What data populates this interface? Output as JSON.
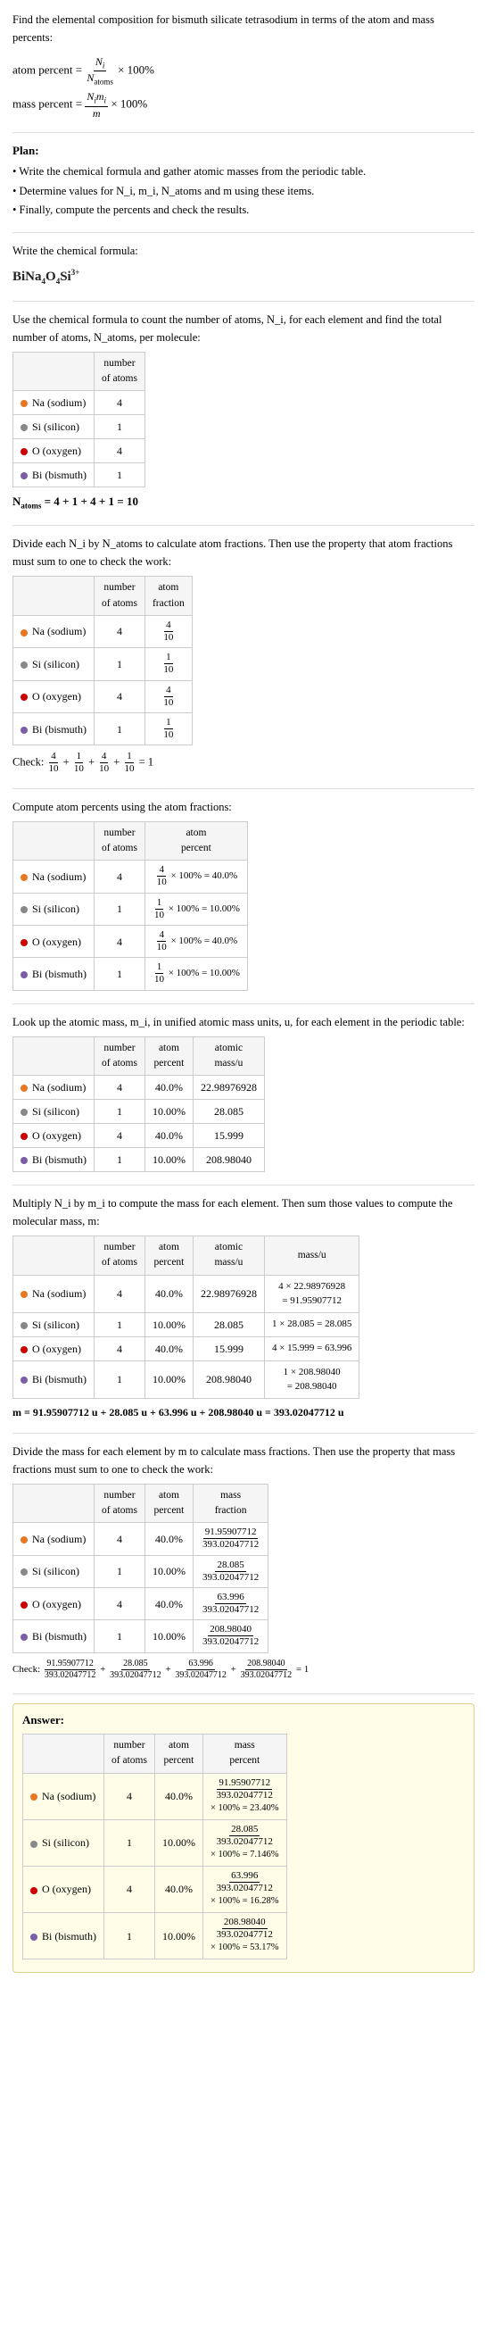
{
  "intro": {
    "title": "Find the elemental composition for bismuth silicate tetrasodium in terms of the atom and mass percents:",
    "atom_percent_formula": "atom percent = (N_i / N_atoms) × 100%",
    "mass_percent_formula": "mass percent = (N_i m_i / m) × 100%"
  },
  "plan": {
    "label": "Plan:",
    "steps": [
      "Write the chemical formula and gather atomic masses from the periodic table.",
      "Determine values for N_i, m_i, N_atoms and m using these items.",
      "Finally, compute the percents and check the results."
    ]
  },
  "formula": {
    "label": "Write the chemical formula:",
    "value": "BiNa₄O₄Si³⁺"
  },
  "step1": {
    "intro": "Use the chemical formula to count the number of atoms, N_i, for each element and find the total number of atoms, N_atoms, per molecule:",
    "columns": [
      "",
      "number of atoms"
    ],
    "rows": [
      {
        "element": "Na (sodium)",
        "color": "orange",
        "n_atoms": "4"
      },
      {
        "element": "Si (silicon)",
        "color": "gray",
        "n_atoms": "1"
      },
      {
        "element": "O (oxygen)",
        "color": "red",
        "n_atoms": "4"
      },
      {
        "element": "Bi (bismuth)",
        "color": "purple",
        "n_atoms": "1"
      }
    ],
    "natoms_eq": "N_atoms = 4 + 1 + 4 + 1 = 10"
  },
  "step2": {
    "intro": "Divide each N_i by N_atoms to calculate atom fractions. Then use the property that atom fractions must sum to one to check the work:",
    "columns": [
      "",
      "number of atoms",
      "atom fraction"
    ],
    "rows": [
      {
        "element": "Na (sodium)",
        "color": "orange",
        "n_atoms": "4",
        "fraction": "4/10"
      },
      {
        "element": "Si (silicon)",
        "color": "gray",
        "n_atoms": "1",
        "fraction": "1/10"
      },
      {
        "element": "O (oxygen)",
        "color": "red",
        "n_atoms": "4",
        "fraction": "4/10"
      },
      {
        "element": "Bi (bismuth)",
        "color": "purple",
        "n_atoms": "1",
        "fraction": "1/10"
      }
    ],
    "check": "Check: 4/10 + 1/10 + 4/10 + 1/10 = 1"
  },
  "step3": {
    "intro": "Compute atom percents using the atom fractions:",
    "columns": [
      "",
      "number of atoms",
      "atom percent"
    ],
    "rows": [
      {
        "element": "Na (sodium)",
        "color": "orange",
        "n_atoms": "4",
        "percent_calc": "4/10 × 100% = 40.0%"
      },
      {
        "element": "Si (silicon)",
        "color": "gray",
        "n_atoms": "1",
        "percent_calc": "1/10 × 100% = 10.00%"
      },
      {
        "element": "O (oxygen)",
        "color": "red",
        "n_atoms": "4",
        "percent_calc": "4/10 × 100% = 40.0%"
      },
      {
        "element": "Bi (bismuth)",
        "color": "purple",
        "n_atoms": "1",
        "percent_calc": "1/10 × 100% = 10.00%"
      }
    ]
  },
  "step4": {
    "intro": "Look up the atomic mass, m_i, in unified atomic mass units, u, for each element in the periodic table:",
    "columns": [
      "",
      "number of atoms",
      "atom percent",
      "atomic mass/u"
    ],
    "rows": [
      {
        "element": "Na (sodium)",
        "color": "orange",
        "n_atoms": "4",
        "atom_pct": "40.0%",
        "mass": "22.98976928"
      },
      {
        "element": "Si (silicon)",
        "color": "gray",
        "n_atoms": "1",
        "atom_pct": "10.00%",
        "mass": "28.085"
      },
      {
        "element": "O (oxygen)",
        "color": "red",
        "n_atoms": "4",
        "atom_pct": "40.0%",
        "mass": "15.999"
      },
      {
        "element": "Bi (bismuth)",
        "color": "purple",
        "n_atoms": "1",
        "atom_pct": "10.00%",
        "mass": "208.98040"
      }
    ]
  },
  "step5": {
    "intro": "Multiply N_i by m_i to compute the mass for each element. Then sum those values to compute the molecular mass, m:",
    "columns": [
      "",
      "number of atoms",
      "atom percent",
      "atomic mass/u",
      "mass/u"
    ],
    "rows": [
      {
        "element": "Na (sodium)",
        "color": "orange",
        "n_atoms": "4",
        "atom_pct": "40.0%",
        "mass": "22.98976928",
        "mass_calc": "4 × 22.98976928\n= 91.95907712"
      },
      {
        "element": "Si (silicon)",
        "color": "gray",
        "n_atoms": "1",
        "atom_pct": "10.00%",
        "mass": "28.085",
        "mass_calc": "1 × 28.085 = 28.085"
      },
      {
        "element": "O (oxygen)",
        "color": "red",
        "n_atoms": "4",
        "atom_pct": "40.0%",
        "mass": "15.999",
        "mass_calc": "4 × 15.999 = 63.996"
      },
      {
        "element": "Bi (bismuth)",
        "color": "purple",
        "n_atoms": "1",
        "atom_pct": "10.00%",
        "mass": "208.98040",
        "mass_calc": "1 × 208.98040\n= 208.98040"
      }
    ],
    "m_eq": "m = 91.95907712 u + 28.085 u + 63.996 u + 208.98040 u = 393.02047712 u"
  },
  "step6": {
    "intro": "Divide the mass for each element by m to calculate mass fractions. Then use the property that mass fractions must sum to one to check the work:",
    "columns": [
      "",
      "number of atoms",
      "atom percent",
      "mass fraction"
    ],
    "rows": [
      {
        "element": "Na (sodium)",
        "color": "orange",
        "n_atoms": "4",
        "atom_pct": "40.0%",
        "fraction": "91.95907712/393.02047712"
      },
      {
        "element": "Si (silicon)",
        "color": "gray",
        "n_atoms": "1",
        "atom_pct": "10.00%",
        "fraction": "28.085/393.02047712"
      },
      {
        "element": "O (oxygen)",
        "color": "red",
        "n_atoms": "4",
        "atom_pct": "40.0%",
        "fraction": "63.996/393.02047712"
      },
      {
        "element": "Bi (bismuth)",
        "color": "purple",
        "n_atoms": "1",
        "atom_pct": "10.00%",
        "fraction": "208.98040/393.02047712"
      }
    ],
    "check": "Check: 91.95907712/393.02047712 + 28.085/393.02047712 + 63.996/393.02047712 + 208.98040/393.02047712 = 1"
  },
  "answer": {
    "label": "Answer:",
    "columns": [
      "",
      "number of atoms",
      "atom percent",
      "mass percent"
    ],
    "rows": [
      {
        "element": "Na (sodium)",
        "color": "orange",
        "n_atoms": "4",
        "atom_pct": "40.0%",
        "mass_pct_calc": "91.95907712/393.02047712\n× 100% = 23.40%"
      },
      {
        "element": "Si (silicon)",
        "color": "gray",
        "n_atoms": "1",
        "atom_pct": "10.00%",
        "mass_pct_calc": "28.085/393.02047712\n× 100% = 7.146%"
      },
      {
        "element": "O (oxygen)",
        "color": "red",
        "n_atoms": "4",
        "atom_pct": "40.0%",
        "mass_pct_calc": "63.996/393.02047712\n× 100% = 16.28%"
      },
      {
        "element": "Bi (bismuth)",
        "color": "purple",
        "n_atoms": "1",
        "atom_pct": "10.00%",
        "mass_pct_calc": "208.98040/393.02047712\n× 100% = 53.17%"
      }
    ]
  },
  "colors": {
    "orange": "#e87722",
    "gray": "#888888",
    "red": "#cc0000",
    "purple": "#7b5ea7"
  }
}
